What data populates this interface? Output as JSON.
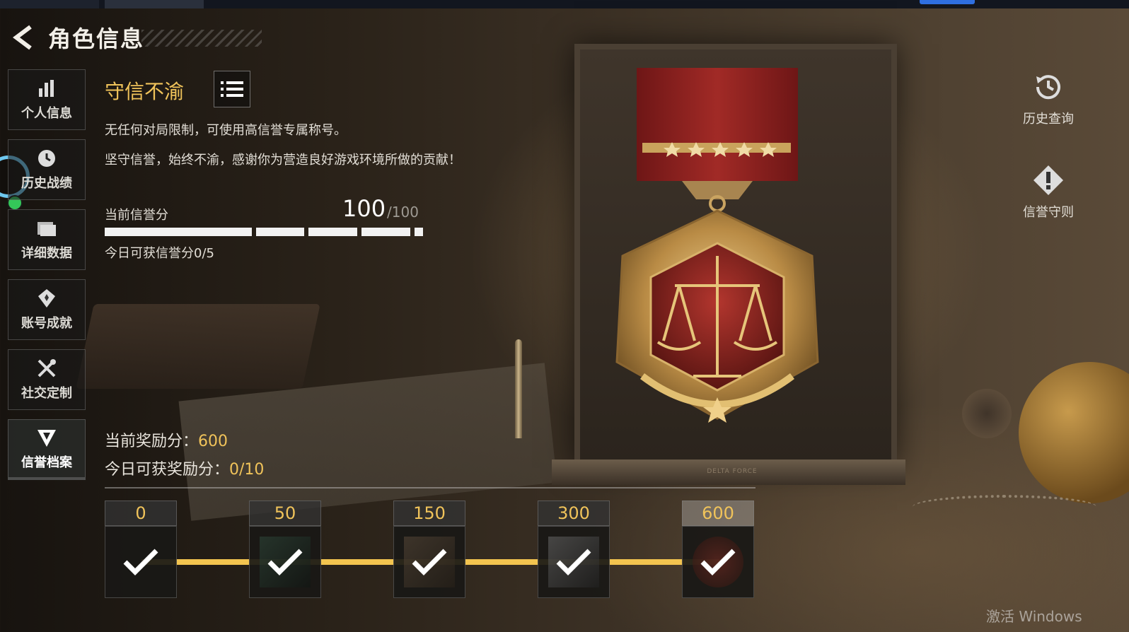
{
  "header": {
    "title": "角色信息"
  },
  "sidebar": {
    "items": [
      {
        "label": "个人信息",
        "icon": "bar-chart-icon"
      },
      {
        "label": "历史战绩",
        "icon": "clock-icon"
      },
      {
        "label": "详细数据",
        "icon": "folder-icon"
      },
      {
        "label": "账号成就",
        "icon": "achievement-icon"
      },
      {
        "label": "社交定制",
        "icon": "tools-icon"
      },
      {
        "label": "信誉档案",
        "icon": "credit-shield-icon",
        "active": true
      }
    ]
  },
  "honor": {
    "title": "守信不渝",
    "desc1": "无任何对局限制，可使用高信誉专属称号。",
    "desc2": "坚守信誉，始终不渝，感谢你为营造良好游戏环境所做的贡献！"
  },
  "credit": {
    "label": "当前信誉分",
    "value": "100",
    "max": "/100",
    "progress": 1.0,
    "today": "今日可获信誉分0/5"
  },
  "reward": {
    "current_label": "当前奖励分：",
    "current_value": "600",
    "today_label": "今日可获奖励分：",
    "today_value": "0/10"
  },
  "milestones": [
    {
      "value": "0",
      "claimed": true
    },
    {
      "value": "50",
      "claimed": true
    },
    {
      "value": "150",
      "claimed": true
    },
    {
      "value": "300",
      "claimed": true
    },
    {
      "value": "600",
      "claimed": true
    }
  ],
  "right": {
    "history_label": "历史查询",
    "rules_label": "信誉守则"
  },
  "scene": {
    "plaque_text": "DELTA FORCE"
  },
  "watermark": "激活 Windows",
  "colors": {
    "gold": "#f0c35a",
    "track": "#f3c44f",
    "active": "#3bd28a"
  }
}
